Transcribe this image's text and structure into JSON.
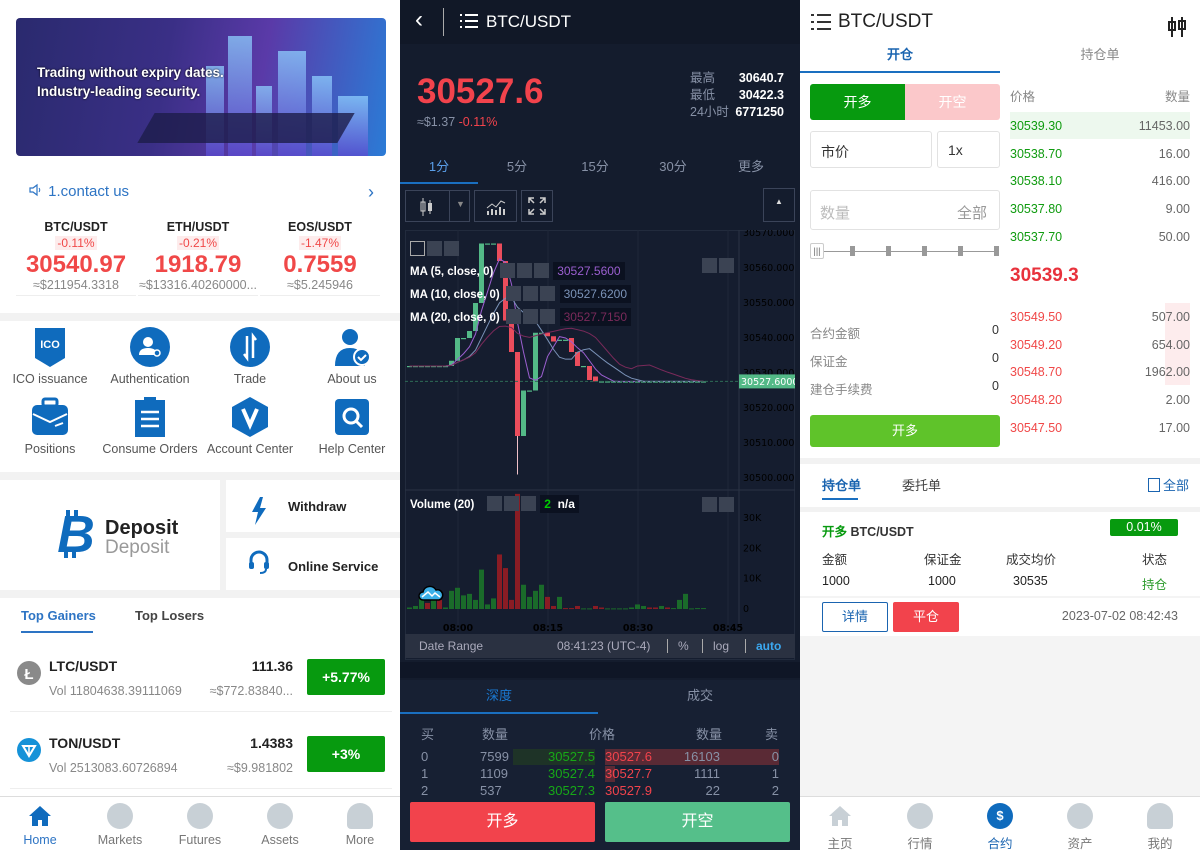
{
  "home": {
    "banner": {
      "line1": "Trading without expiry dates.",
      "line2": "Industry-leading security."
    },
    "notice": "1.contact us",
    "tickers": [
      {
        "pair": "BTC/USDT",
        "change": "-0.11%",
        "price": "30540.97",
        "usd": "≈$211954.3318"
      },
      {
        "pair": "ETH/USDT",
        "change": "-0.21%",
        "price": "1918.79",
        "usd": "≈$13316.40260000..."
      },
      {
        "pair": "EOS/USDT",
        "change": "-1.47%",
        "price": "0.7559",
        "usd": "≈$5.245946"
      }
    ],
    "grid": [
      {
        "label": "ICO issuance",
        "icon": "ico-icon"
      },
      {
        "label": "Authentication",
        "icon": "authentication-icon"
      },
      {
        "label": "Trade",
        "icon": "trade-icon"
      },
      {
        "label": "About us",
        "icon": "about-us-icon"
      },
      {
        "label": "Positions",
        "icon": "briefcase-icon"
      },
      {
        "label": "Consume Orders",
        "icon": "clipboard-icon"
      },
      {
        "label": "Account Center",
        "icon": "account-center-icon"
      },
      {
        "label": "Help Center",
        "icon": "help-search-icon"
      }
    ],
    "deposit": {
      "title": "Deposit",
      "subtitle": "Deposit"
    },
    "withdraw": "Withdraw",
    "online_service": "Online Service",
    "tabs": [
      "Top Gainers",
      "Top Losers"
    ],
    "list": [
      {
        "pair": "LTC/USDT",
        "price": "111.36",
        "vol": "Vol 11804638.39111069",
        "usd": "≈$772.83840...",
        "change": "+5.77%"
      },
      {
        "pair": "TON/USDT",
        "price": "1.4383",
        "vol": "Vol 2513083.60726894",
        "usd": "≈$9.981802",
        "change": "+3%"
      }
    ],
    "nav": [
      "Home",
      "Markets",
      "Futures",
      "Assets",
      "More"
    ]
  },
  "kline": {
    "title": "BTC/USDT",
    "price": "30527.6",
    "usd": "≈$1.37",
    "change": "-0.11%",
    "stats": [
      {
        "label": "最高",
        "value": "30640.7"
      },
      {
        "label": "最低",
        "value": "30422.3"
      },
      {
        "label": "24小时",
        "value": "6771250"
      }
    ],
    "intervals": [
      "1分",
      "5分",
      "15分",
      "30分",
      "更多"
    ],
    "ma": [
      {
        "label": "MA (5, close, 0)",
        "value": "30527.5600",
        "color": "#9b5fd0"
      },
      {
        "label": "MA (10, close, 0)",
        "value": "30527.6200",
        "color": "#7b93b8"
      },
      {
        "label": "MA (20, close, 0)",
        "value": "30527.7150",
        "color": "#7a2a5a"
      }
    ],
    "price_axis": [
      "30570.0000",
      "30560.0000",
      "30550.0000",
      "30540.0000",
      "30530.0000",
      "30520.0000",
      "30510.0000",
      "30500.0000"
    ],
    "last_price_tag": "30527.6000",
    "volume_label": "Volume (20)",
    "volume_value_index": "2",
    "volume_value": "n/a",
    "volume_axis": [
      "30K",
      "20K",
      "10K",
      "0"
    ],
    "time_axis": [
      "08:00",
      "08:15",
      "08:30",
      "08:45"
    ],
    "date_range": "Date Range",
    "clock": "08:41:23 (UTC-4)",
    "scale_opts": [
      "%",
      "log",
      "auto"
    ],
    "colors": {
      "up": "#53b987",
      "down": "#eb4d5c",
      "vol_up": "#1a6b2a",
      "vol_down": "#8a1c24"
    },
    "candles": [
      [
        30532,
        30532
      ],
      [
        30532,
        30532
      ],
      [
        30532,
        30532
      ],
      [
        30532,
        30532
      ],
      [
        30532,
        30532
      ],
      [
        30532,
        30532
      ],
      [
        30532,
        30532
      ],
      [
        30532,
        30533.5
      ],
      [
        30533.5,
        30540
      ],
      [
        30540,
        30540
      ],
      [
        30540,
        30542
      ],
      [
        30542,
        30550
      ],
      [
        30550,
        30567
      ],
      [
        30567,
        30567
      ],
      [
        30567,
        30567
      ],
      [
        30567,
        30562
      ],
      [
        30562,
        30545
      ],
      [
        30545,
        30536
      ],
      [
        30536,
        30512,
        30501
      ],
      [
        30512,
        30525
      ],
      [
        30525,
        30525
      ],
      [
        30525,
        30541.5
      ],
      [
        30541.5,
        30541.5
      ],
      [
        30541.5,
        30540.5
      ],
      [
        30540.5,
        30539
      ],
      [
        30539.5,
        30539.5
      ],
      [
        30539.5,
        30539.5
      ],
      [
        30540,
        30536
      ],
      [
        30536,
        30532
      ],
      [
        30532,
        30532
      ],
      [
        30532,
        30528
      ],
      [
        30529,
        30527.6
      ],
      [
        30527.6,
        30527.6
      ],
      [
        30527.6,
        30527.6
      ],
      [
        30527.6,
        30527.6
      ],
      [
        30527.6,
        30527.6
      ],
      [
        30527.6,
        30527.6
      ],
      [
        30527.6,
        30527.6
      ],
      [
        30527.6,
        30527.6
      ],
      [
        30527.6,
        30527.6
      ],
      [
        30527.6,
        30527.6
      ],
      [
        30527.6,
        30527.6
      ],
      [
        30527.6,
        30527.6
      ],
      [
        30527.6,
        30527.6
      ],
      [
        30527.6,
        30527.6
      ],
      [
        30527.6,
        30527.6
      ],
      [
        30527.6,
        30527.6
      ],
      [
        30527.6,
        30527.6
      ],
      [
        30527.6,
        30527.6
      ],
      [
        30527.6,
        30527.6
      ]
    ],
    "volumes": [
      [
        0.5,
        "up"
      ],
      [
        1,
        "up"
      ],
      [
        5,
        "up"
      ],
      [
        2,
        "down"
      ],
      [
        3,
        "up"
      ],
      [
        3,
        "down"
      ],
      [
        0.5,
        "up"
      ],
      [
        6,
        "up"
      ],
      [
        7,
        "up"
      ],
      [
        4.5,
        "up"
      ],
      [
        5,
        "up"
      ],
      [
        3,
        "up"
      ],
      [
        13,
        "up"
      ],
      [
        1.5,
        "up"
      ],
      [
        3.5,
        "up"
      ],
      [
        18,
        "down"
      ],
      [
        13.5,
        "down"
      ],
      [
        3,
        "down"
      ],
      [
        38,
        "down"
      ],
      [
        8,
        "up"
      ],
      [
        4,
        "up"
      ],
      [
        6,
        "up"
      ],
      [
        8,
        "up"
      ],
      [
        4,
        "down"
      ],
      [
        1,
        "down"
      ],
      [
        4,
        "up"
      ],
      [
        0.3,
        "down"
      ],
      [
        0.3,
        "down"
      ],
      [
        1,
        "down"
      ],
      [
        0.2,
        "up"
      ],
      [
        0.2,
        "up"
      ],
      [
        1,
        "down"
      ],
      [
        0.5,
        "down"
      ],
      [
        0.2,
        "up"
      ],
      [
        0.2,
        "up"
      ],
      [
        0.2,
        "up"
      ],
      [
        0.2,
        "up"
      ],
      [
        0.5,
        "up"
      ],
      [
        1.5,
        "up"
      ],
      [
        1,
        "up"
      ],
      [
        0.5,
        "down"
      ],
      [
        0.5,
        "down"
      ],
      [
        1,
        "up"
      ],
      [
        0.5,
        "down"
      ],
      [
        0.3,
        "up"
      ],
      [
        3,
        "up"
      ],
      [
        5,
        "up"
      ],
      [
        0.2,
        "up"
      ],
      [
        0.3,
        "up"
      ],
      [
        0.3,
        "up"
      ]
    ],
    "depth_tabs": [
      "深度",
      "成交"
    ],
    "depth_headers": [
      "买",
      "数量",
      "价格",
      "数量",
      "卖"
    ],
    "depth_rows": [
      {
        "i": "0",
        "bq": "7599",
        "bp": "30527.5",
        "sp": "30527.6",
        "sq": "16103",
        "j": "0"
      },
      {
        "i": "1",
        "bq": "1109",
        "bp": "30527.4",
        "sp": "30527.7",
        "sq": "1111",
        "j": "1"
      },
      {
        "i": "2",
        "bq": "537",
        "bp": "30527.3",
        "sp": "30527.9",
        "sq": "22",
        "j": "2"
      }
    ],
    "buy_button": "开多",
    "sell_button": "开空"
  },
  "trade": {
    "title": "BTC/USDT",
    "tabs": [
      "开仓",
      "持仓单"
    ],
    "side": [
      "开多",
      "开空"
    ],
    "order_type": "市价",
    "leverage": "1x",
    "qty_placeholder": "数量",
    "qty_all": "全部",
    "slider_value": 0,
    "info": [
      {
        "label": "合约金额",
        "value": "0"
      },
      {
        "label": "保证金",
        "value": "0"
      },
      {
        "label": "建仓手续费",
        "value": "0"
      }
    ],
    "submit": "开多",
    "book_headers": [
      "价格",
      "数量"
    ],
    "bids": [
      [
        "30539.30",
        "11453.00"
      ],
      [
        "30538.70",
        "16.00"
      ],
      [
        "30538.10",
        "416.00"
      ],
      [
        "30537.80",
        "9.00"
      ],
      [
        "30537.70",
        "50.00"
      ]
    ],
    "mid": "30539.3",
    "asks": [
      [
        "30549.50",
        "507.00"
      ],
      [
        "30549.20",
        "654.00"
      ],
      [
        "30548.70",
        "1962.00"
      ],
      [
        "30548.20",
        "2.00"
      ],
      [
        "30547.50",
        "17.00"
      ]
    ],
    "order_tabs": [
      "持仓单",
      "委托单"
    ],
    "all_link": "全部",
    "position": {
      "side": "开多",
      "pair": "BTC/USDT",
      "pnl": "0.01%",
      "headers": [
        "金额",
        "保证金",
        "成交均价",
        "状态"
      ],
      "values": [
        "1000",
        "1000",
        "30535",
        "持仓"
      ],
      "detail": "详情",
      "close": "平仓",
      "time": "2023-07-02 08:42:43"
    },
    "nav": [
      "主页",
      "行情",
      "合约",
      "资产",
      "我的"
    ]
  }
}
